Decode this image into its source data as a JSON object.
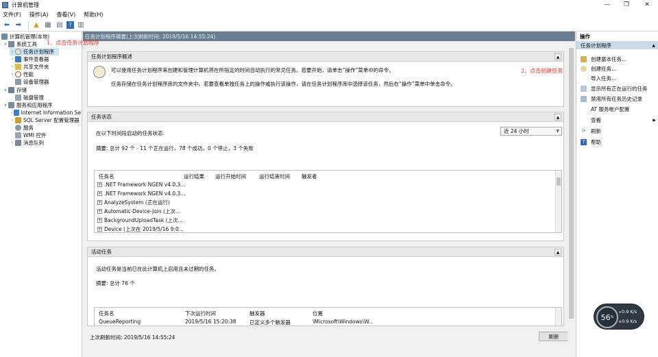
{
  "window": {
    "title": "计算机管理"
  },
  "menu": [
    "文件(F)",
    "操作(A)",
    "查看(V)",
    "帮助(H)"
  ],
  "tree": {
    "root": "计算机管理(本地)",
    "system_tools": "系统工具",
    "task_scheduler": "任务计划程序",
    "event_viewer": "事件查看器",
    "shared_folders": "共享文件夹",
    "performance": "性能",
    "device_manager": "设备管理器",
    "storage": "存储",
    "disk_management": "磁盘管理",
    "services_apps": "服务和应用程序",
    "iis": "Internet Information Se",
    "sql": "SQL Server 配置管理器",
    "services": "服务",
    "wmi": "WMI 控件",
    "mq": "消息队列"
  },
  "center": {
    "header": "任务计划程序摘要(上次刷新时间: 2019/5/16 14:55:24)",
    "overview": {
      "title": "任务计划程序概述",
      "line1": "可以使用任务计划程序来创建和管理计算机将在所指定的时间自动执行的常见任务。若要开始，请单击“操作”菜单中的命令。",
      "line2": "任务存储在任务计划程序库的文件夹中。若要查看单独任务上的操作或执行该操作，请在任务计划程序库中选择该任务，然后在“操作”菜单中单击命令。"
    },
    "status": {
      "title": "任务状态",
      "prompt": "在以下时间段启动的任务状态:",
      "period": "近 24 小时",
      "summary": "摘要: 总计 92 个 - 11 个正在运行，78 个成功，0 个停止，3 个失败",
      "headers": [
        "任务名",
        "运行结果",
        "运行开始时间",
        "运行结束时间",
        "触发者"
      ],
      "rows": [
        ".NET Framework NGEN v4.0.3...",
        ".NET Framework NGEN v4.0.3...",
        "AnalyzeSystem (正在运行)",
        "Automatic-Device-Join (上次...",
        "BackgroundUploadTask (上次...",
        "Device (上次在 2019/5/16 9:0..."
      ]
    },
    "active": {
      "title": "活动任务",
      "desc": "活动任务是当前已在此计算机上启用且未过期的任务。",
      "summary": "摘要: 总计 76 个",
      "headers": [
        "任务名",
        "下次运行时间",
        "触发器",
        "位置"
      ],
      "row": [
        "QueueReporting",
        "2019/5/16 15:20:38",
        "已定义多个触发器",
        "\\Microsoft\\Windows\\W..."
      ]
    },
    "last_refresh": "上次刷新时间: 2019/5/16 14:55:24",
    "refresh_btn": "刷新"
  },
  "actions": {
    "title": "操作",
    "section": "任务计划程序",
    "items": [
      "创建基本任务...",
      "创建任务...",
      "导入任务...",
      "显示所有正在运行的任务",
      "禁用所有任务历史记录",
      "AT 服务帐户配置",
      "查看",
      "刷新",
      "帮助"
    ]
  },
  "annotations": {
    "step1": "1、点击任务计划程序",
    "step2": "2、点击创建任务"
  },
  "widget": {
    "percent": "56",
    "unit": "%",
    "up": "0.9",
    "down": "0.9",
    "rate_unit": "K/s"
  }
}
